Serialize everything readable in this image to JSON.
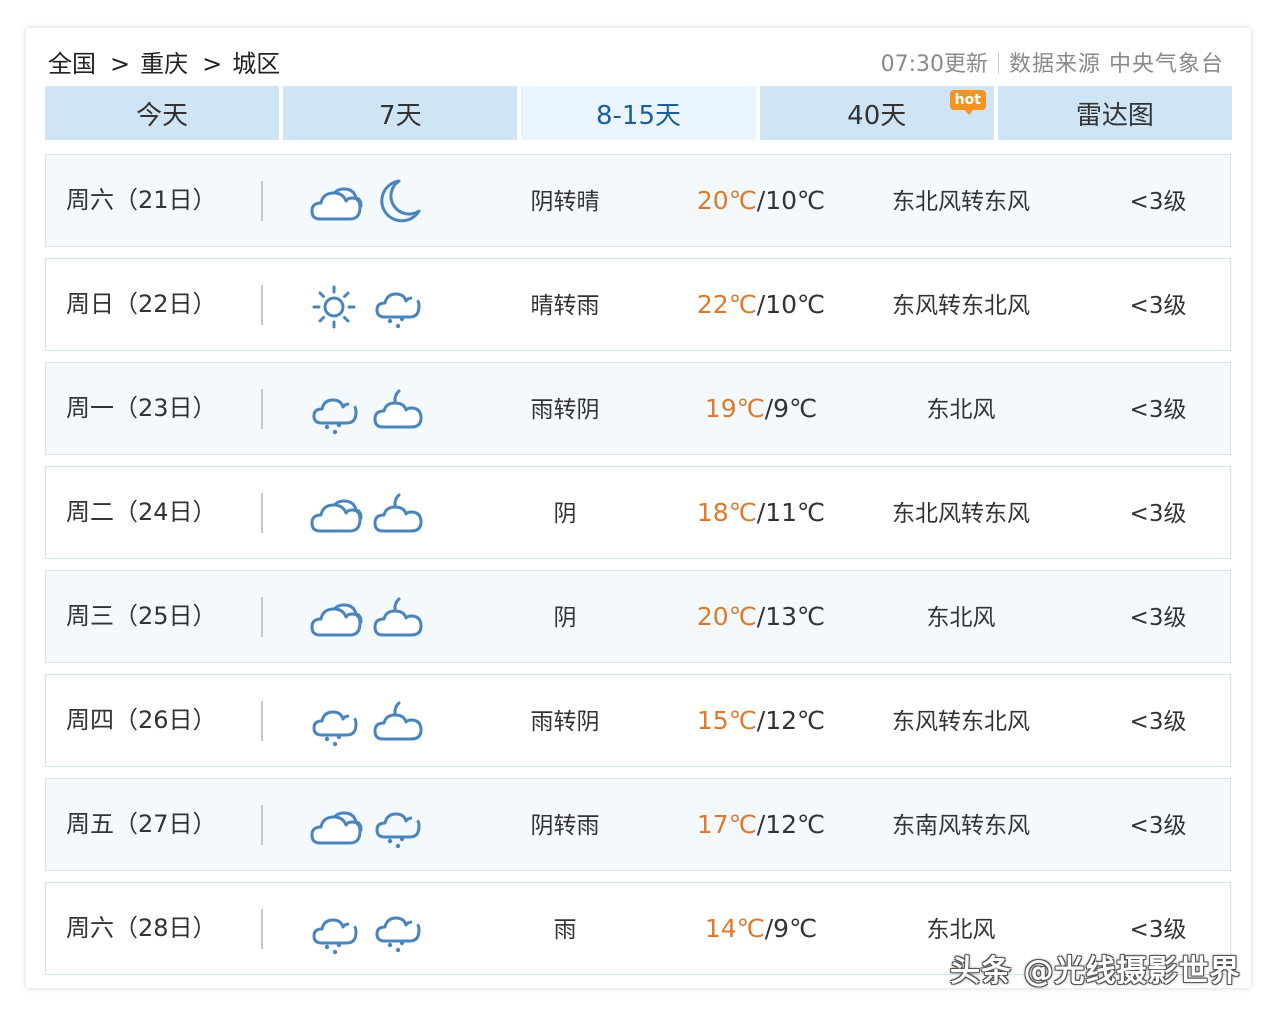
{
  "breadcrumb": {
    "items": [
      "全国",
      "重庆",
      "城区"
    ],
    "separator": ">"
  },
  "update": {
    "time": "07:30更新",
    "source": "数据来源 中央气象台"
  },
  "tabs": [
    {
      "label": "今天"
    },
    {
      "label": "7天"
    },
    {
      "label": "8-15天",
      "active": true
    },
    {
      "label": "40天",
      "badge": "hot"
    },
    {
      "label": "雷达图"
    }
  ],
  "colors": {
    "tab_bg": "#cfe4f5",
    "tab_active_bg": "#e9f4fc",
    "tab_active_text": "#1c5f9c",
    "high_temp": "#e07a2a",
    "hot_badge": "#f39324",
    "icon_blue": "#4a86bd"
  },
  "forecast": [
    {
      "day": "周六（21日）",
      "icon_day": "cloudy-icon",
      "icon_night": "moon-icon",
      "weather": "阴转晴",
      "high": "20℃",
      "low": "10℃",
      "wind": "东北风转东风",
      "level": "<3级"
    },
    {
      "day": "周日（22日）",
      "icon_day": "sun-icon",
      "icon_night": "rain-icon",
      "weather": "晴转雨",
      "high": "22℃",
      "low": "10℃",
      "wind": "东风转东北风",
      "level": "<3级"
    },
    {
      "day": "周一（23日）",
      "icon_day": "rain-icon",
      "icon_night": "cloudy-night-icon",
      "weather": "雨转阴",
      "high": "19℃",
      "low": "9℃",
      "wind": "东北风",
      "level": "<3级"
    },
    {
      "day": "周二（24日）",
      "icon_day": "cloudy-icon",
      "icon_night": "cloudy-night-icon",
      "weather": "阴",
      "high": "18℃",
      "low": "11℃",
      "wind": "东北风转东风",
      "level": "<3级"
    },
    {
      "day": "周三（25日）",
      "icon_day": "cloudy-icon",
      "icon_night": "cloudy-night-icon",
      "weather": "阴",
      "high": "20℃",
      "low": "13℃",
      "wind": "东北风",
      "level": "<3级"
    },
    {
      "day": "周四（26日）",
      "icon_day": "rain-icon",
      "icon_night": "cloudy-night-icon",
      "weather": "雨转阴",
      "high": "15℃",
      "low": "12℃",
      "wind": "东风转东北风",
      "level": "<3级"
    },
    {
      "day": "周五（27日）",
      "icon_day": "cloudy-icon",
      "icon_night": "rain-icon",
      "weather": "阴转雨",
      "high": "17℃",
      "low": "12℃",
      "wind": "东南风转东风",
      "level": "<3级"
    },
    {
      "day": "周六（28日）",
      "icon_day": "rain-icon",
      "icon_night": "rain-icon",
      "weather": "雨",
      "high": "14℃",
      "low": "9℃",
      "wind": "东北风",
      "level": "<3级"
    }
  ],
  "watermark": "头条 @光线摄影世界"
}
